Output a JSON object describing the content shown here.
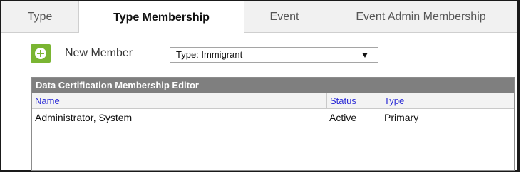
{
  "tabs": [
    {
      "label": "Type",
      "active": false
    },
    {
      "label": "Type Membership",
      "active": true
    },
    {
      "label": "Event",
      "active": false
    },
    {
      "label": "Event Admin Membership",
      "active": false
    }
  ],
  "toolbar": {
    "add_icon": "plus-circle-icon",
    "new_member_label": "New Member",
    "type_select_value": "Type: Immigrant",
    "accent_color": "#7ab532"
  },
  "editor": {
    "title": "Data Certification Membership Editor",
    "columns": [
      "Name",
      "Status",
      "Type"
    ],
    "rows": [
      {
        "name": "Administrator, System",
        "status": "Active",
        "type": "Primary"
      }
    ]
  }
}
